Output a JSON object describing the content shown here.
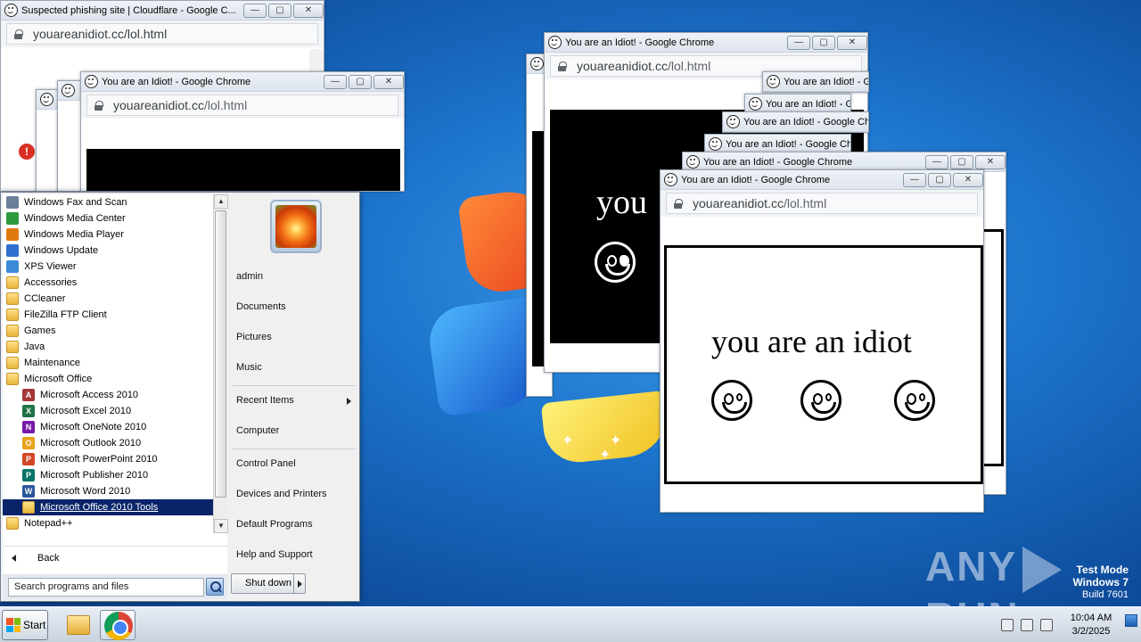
{
  "desktop": {
    "watermark_left": "ANY",
    "watermark_right": "RUN",
    "test_mode": "Test Mode",
    "os_name": "Windows 7",
    "build": "Build 7601"
  },
  "cloudflare_window": {
    "title": "Suspected phishing site | Cloudflare - Google C...",
    "url": "youareanidiot.cc/lol.html"
  },
  "idiot_windows": {
    "title": "You are an Idiot! - Google Chrome",
    "title_short": "You are an Idiot! - Google Ch",
    "title_tiny": "You are an Idiot! - G",
    "url_host": "youareanidiot.cc",
    "url_path": "/lol.html",
    "page_text": "you are an idiot",
    "page_text_cut": "you"
  },
  "start_menu": {
    "programs": [
      {
        "label": "Windows Fax and Scan",
        "icon": "fax-icon",
        "color": "#6b7f99"
      },
      {
        "label": "Windows Media Center",
        "icon": "media-center-icon",
        "color": "#2f9a3d"
      },
      {
        "label": "Windows Media Player",
        "icon": "media-player-icon",
        "color": "#e07a10"
      },
      {
        "label": "Windows Update",
        "icon": "windows-update-icon",
        "color": "#2f6fce"
      },
      {
        "label": "XPS Viewer",
        "icon": "xps-viewer-icon",
        "color": "#3b8ad6"
      },
      {
        "label": "Accessories",
        "icon": "folder-icon"
      },
      {
        "label": "CCleaner",
        "icon": "folder-icon"
      },
      {
        "label": "FileZilla FTP Client",
        "icon": "folder-icon"
      },
      {
        "label": "Games",
        "icon": "folder-icon"
      },
      {
        "label": "Java",
        "icon": "folder-icon"
      },
      {
        "label": "Maintenance",
        "icon": "folder-icon"
      },
      {
        "label": "Microsoft Office",
        "icon": "folder-icon"
      }
    ],
    "office_apps": [
      {
        "label": "Microsoft Access 2010",
        "glyph": "A",
        "color": "#a4373a"
      },
      {
        "label": "Microsoft Excel 2010",
        "glyph": "X",
        "color": "#217346"
      },
      {
        "label": "Microsoft OneNote 2010",
        "glyph": "N",
        "color": "#7719aa"
      },
      {
        "label": "Microsoft Outlook 2010",
        "glyph": "O",
        "color": "#e8a317"
      },
      {
        "label": "Microsoft PowerPoint 2010",
        "glyph": "P",
        "color": "#d24726"
      },
      {
        "label": "Microsoft Publisher 2010",
        "glyph": "P",
        "color": "#077568"
      },
      {
        "label": "Microsoft Word 2010",
        "glyph": "W",
        "color": "#2b579a"
      }
    ],
    "selected_item": "Microsoft Office 2010 Tools",
    "after_item": "Notepad++",
    "back_label": "Back",
    "search_placeholder": "Search programs and files",
    "right_items": {
      "user": "admin",
      "documents": "Documents",
      "pictures": "Pictures",
      "music": "Music",
      "recent": "Recent Items",
      "computer": "Computer",
      "control_panel": "Control Panel",
      "devices": "Devices and Printers",
      "defaults": "Default Programs",
      "help": "Help and Support"
    },
    "shutdown_label": "Shut down"
  },
  "taskbar": {
    "start_label": "Start",
    "time": "10:04 AM",
    "date": "3/2/2025"
  }
}
